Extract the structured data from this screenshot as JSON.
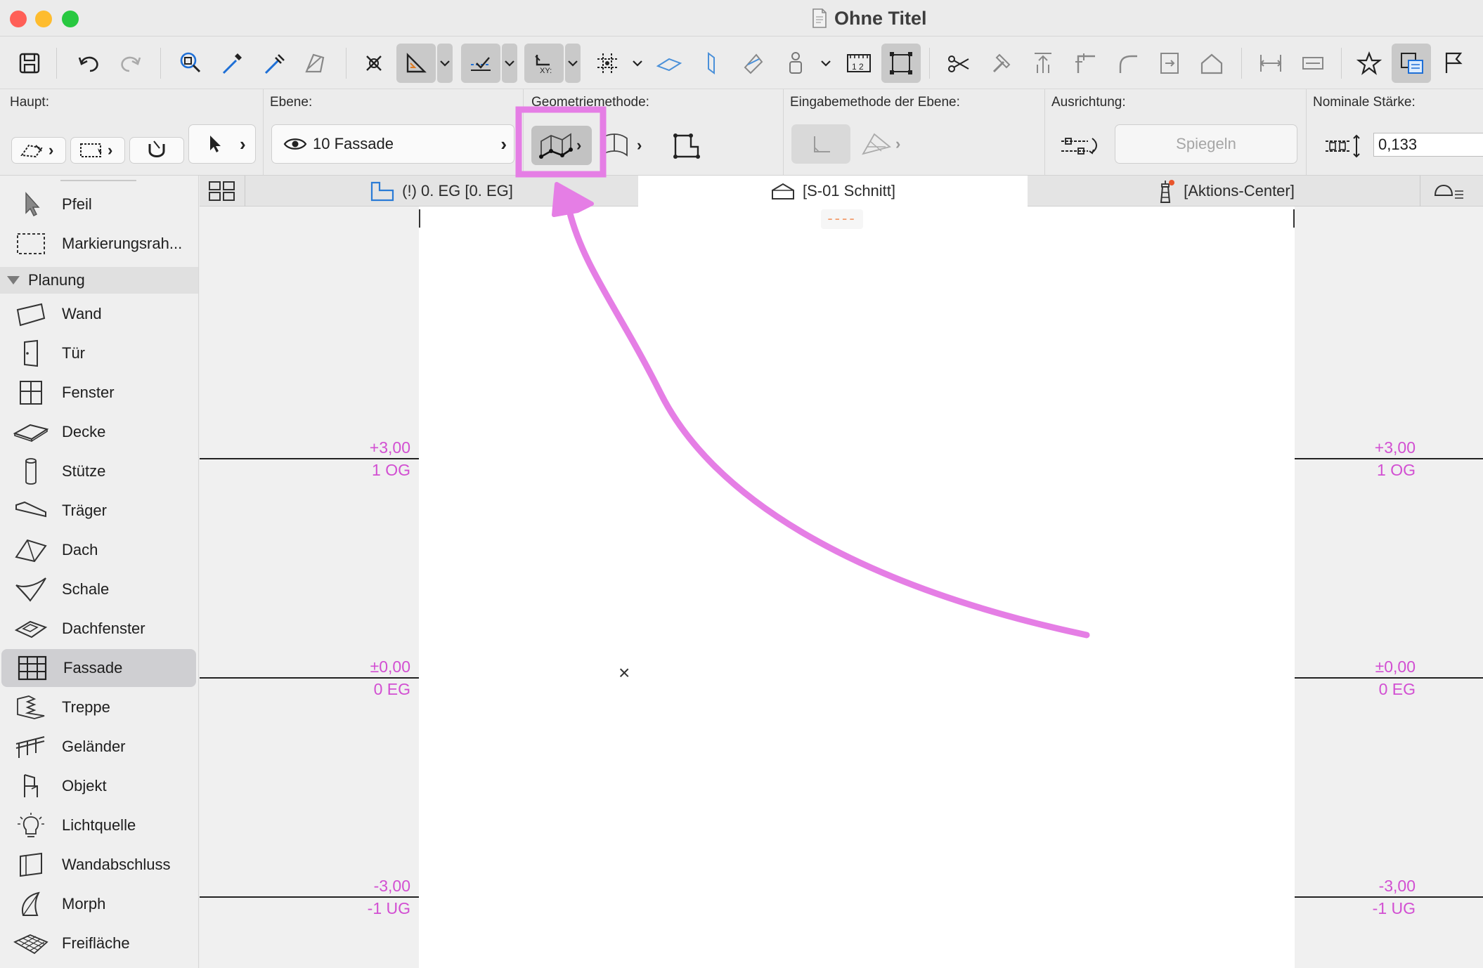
{
  "window": {
    "title": "Ohne Titel"
  },
  "infobox": {
    "main_label": "Haupt:",
    "layer_label": "Ebene:",
    "layer_value": "10 Fassade",
    "geometry_label": "Geometriemethode:",
    "input_method_label": "Eingabemethode der Ebene:",
    "orientation_label": "Ausrichtung:",
    "mirror_button": "Spiegeln",
    "nominal_thickness_label": "Nominale Stärke:",
    "nominal_thickness_value": "0,133"
  },
  "sidebar": {
    "top_items": [
      "Pfeil",
      "Markierungsrah..."
    ],
    "section": "Planung",
    "items": [
      "Wand",
      "Tür",
      "Fenster",
      "Decke",
      "Stütze",
      "Träger",
      "Dach",
      "Schale",
      "Dachfenster",
      "Fassade",
      "Treppe",
      "Geländer",
      "Objekt",
      "Lichtquelle",
      "Wandabschluss",
      "Morph",
      "Freifläche"
    ],
    "selected": "Fassade"
  },
  "tabs": [
    {
      "label": "(!) 0. EG [0. EG]"
    },
    {
      "label": "[S-01 Schnitt]"
    },
    {
      "label": "[Aktions-Center]"
    }
  ],
  "section_view": {
    "stories": [
      {
        "value": "+3,00",
        "name": "1 OG"
      },
      {
        "value": "±0,00",
        "name": "0 EG"
      },
      {
        "value": "-3,00",
        "name": "-1 UG"
      }
    ],
    "center_marker": "----",
    "cross_marker": "×"
  },
  "colors": {
    "annotation": "#e57ee5",
    "story_text": "#d24fd2",
    "selected_bg": "#cfcfd2"
  }
}
